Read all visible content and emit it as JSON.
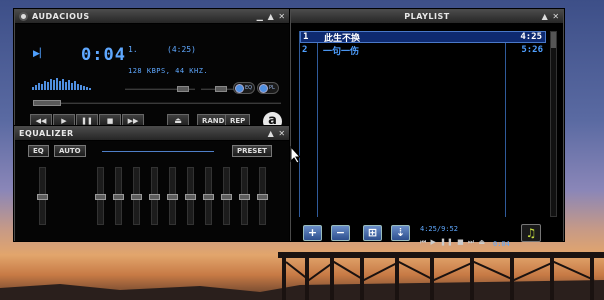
{
  "colors": {
    "lcd": "#5fa8ff",
    "selection": "#0e2a70",
    "desktop_sky": "#5a6aa2"
  },
  "main": {
    "title": "AUDACIOUS",
    "time": "0:04",
    "track_number": "1.",
    "track_length": "(4:25)",
    "bitrate": "128 KBPS, 44 KHZ.",
    "eq_toggle": "EQ",
    "pl_toggle": "PL",
    "rand_label": "RAND",
    "rep_label": "REP",
    "logo_letter": "a"
  },
  "equalizer": {
    "title": "EQUALIZER",
    "eq_label": "EQ",
    "auto_label": "AUTO",
    "preset_label": "PRESET"
  },
  "playlist": {
    "title": "PLAYLIST",
    "items": [
      {
        "num": "1",
        "title": "此生不换",
        "duration": "4:25",
        "selected": true
      },
      {
        "num": "2",
        "title": "一句一伤",
        "duration": "5:26",
        "selected": false
      }
    ],
    "position": "4:25/9:52",
    "time_small": "0:04"
  },
  "icons": [
    "minimize-icon",
    "shade-icon",
    "close-icon",
    "add-icon",
    "remove-icon",
    "select-icon",
    "sort-icon",
    "music-note-icon",
    "play-indicator-icon"
  ]
}
